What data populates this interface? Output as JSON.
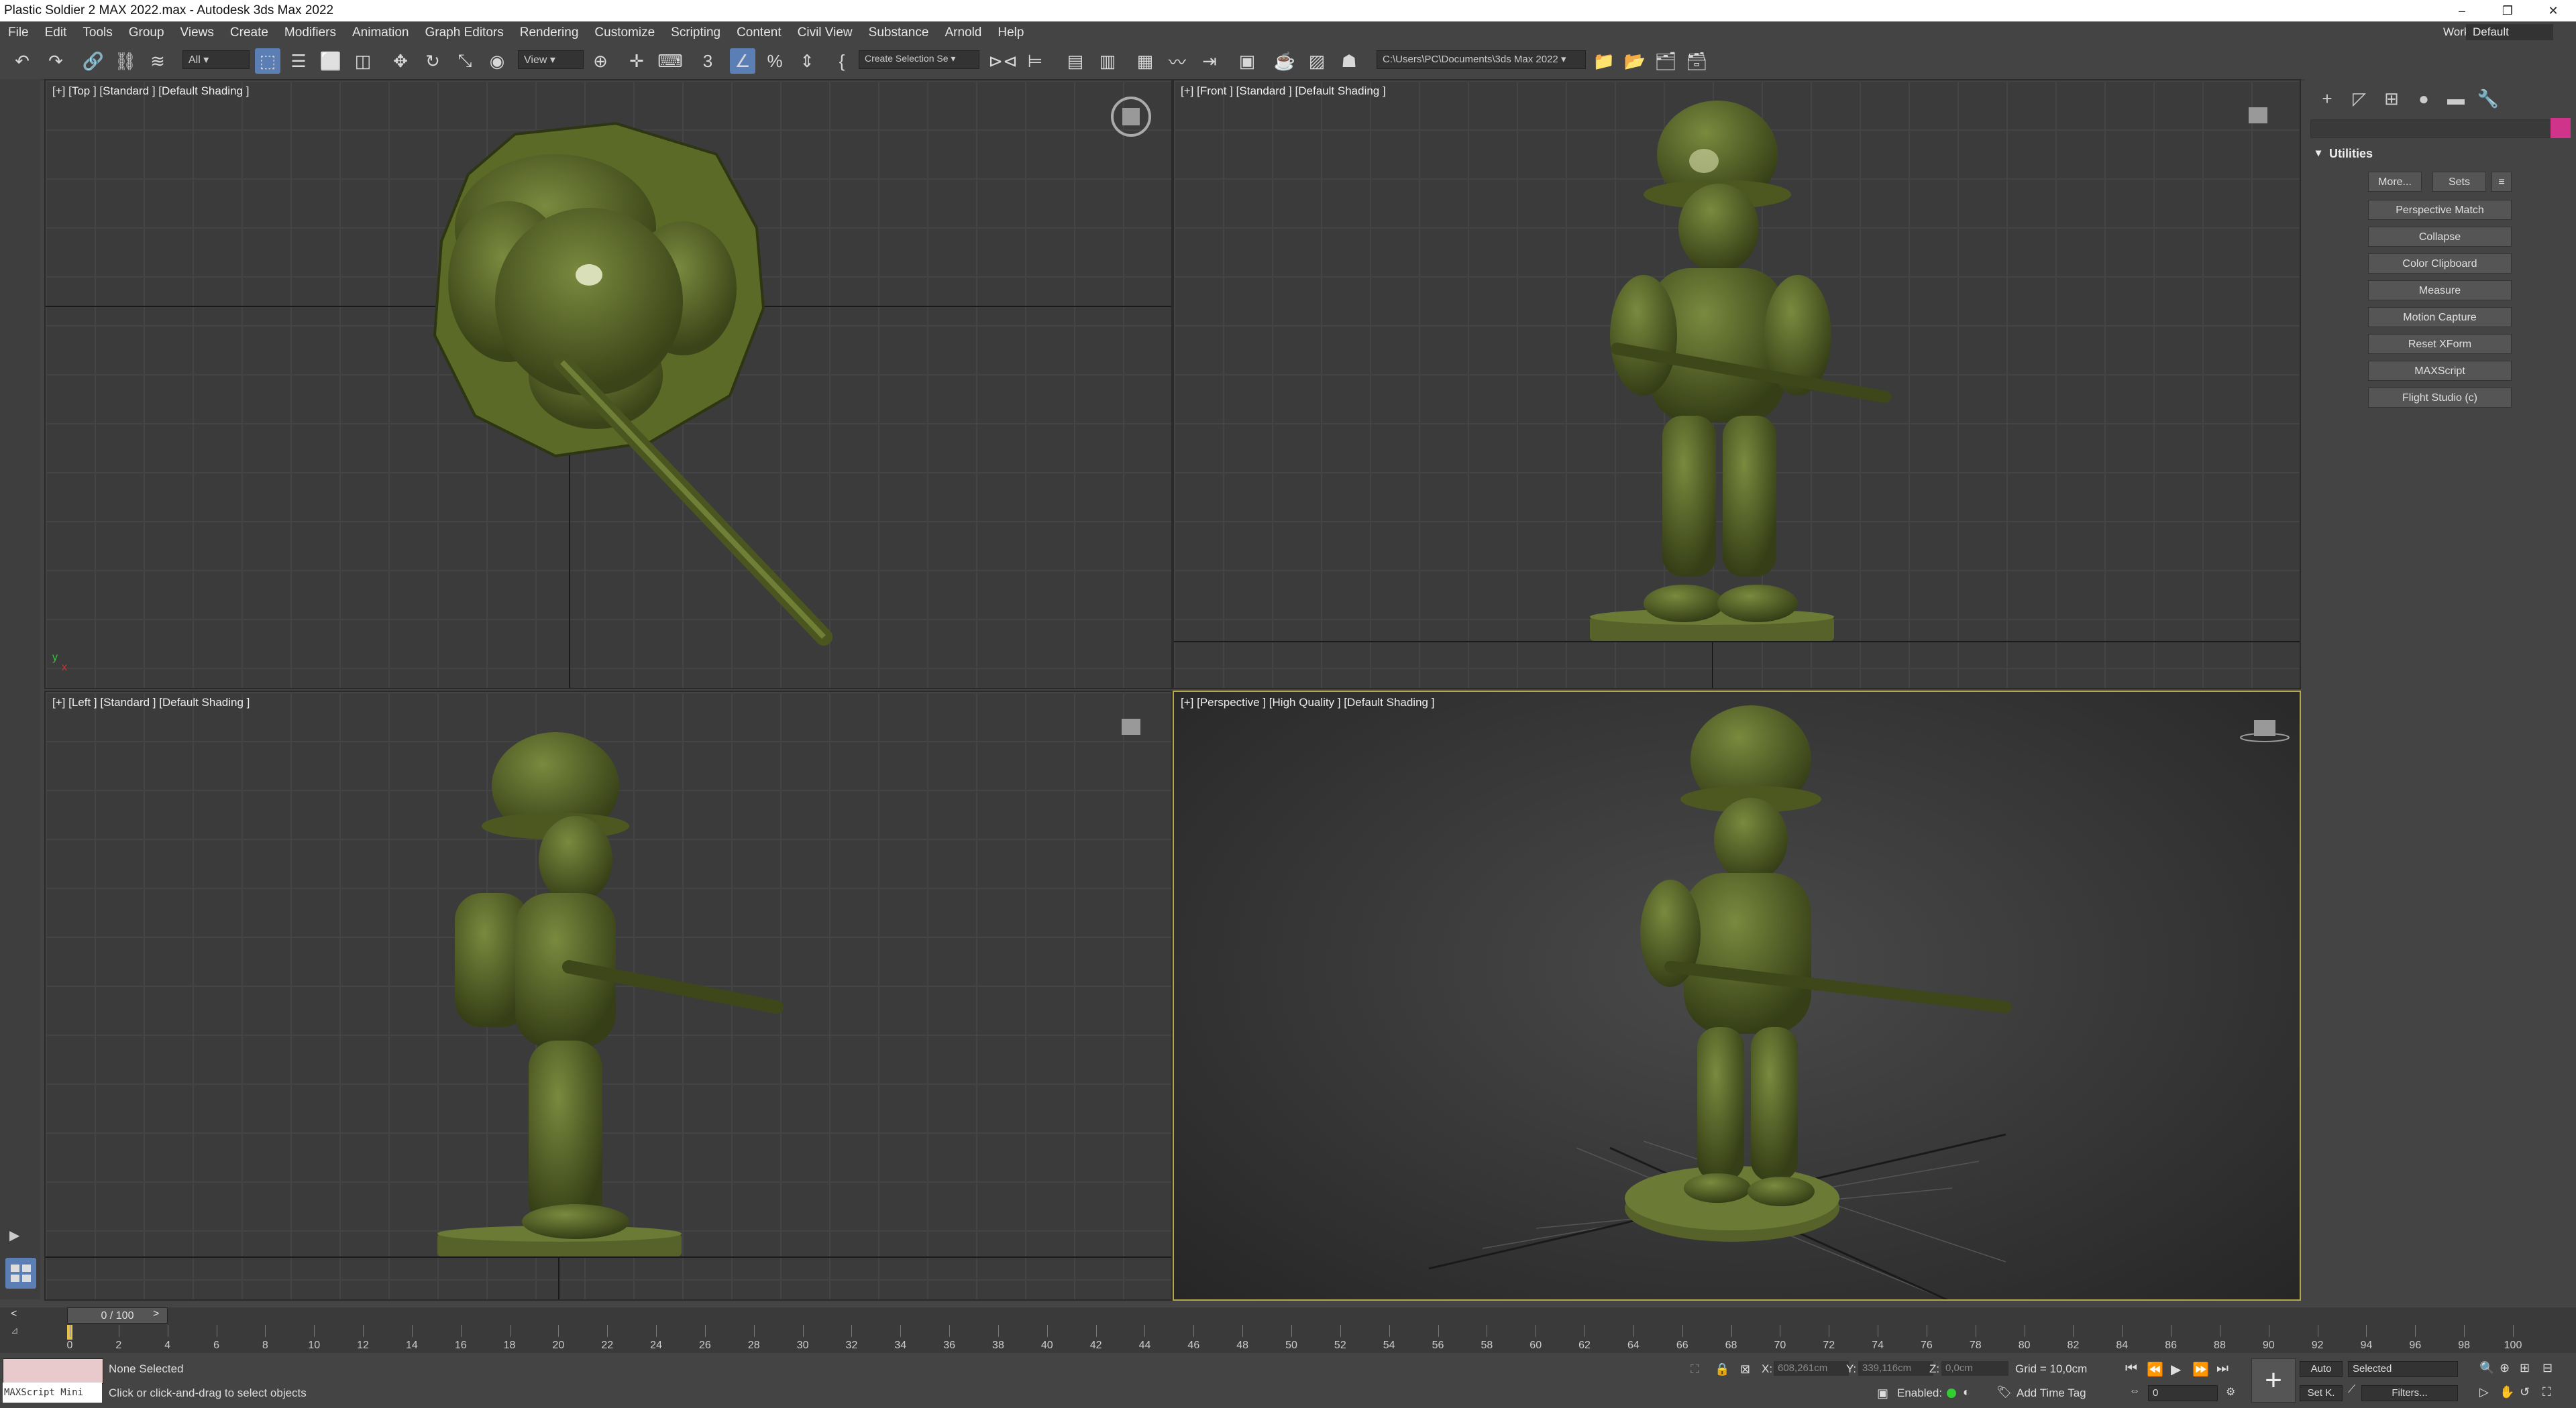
{
  "window": {
    "title": "Plastic Soldier 2 MAX 2022.max - Autodesk 3ds Max 2022",
    "buttons": [
      "–",
      "❐",
      "✕"
    ]
  },
  "menu": {
    "items": [
      "File",
      "Edit",
      "Tools",
      "Group",
      "Views",
      "Create",
      "Modifiers",
      "Animation",
      "Graph Editors",
      "Rendering",
      "Customize",
      "Scripting",
      "Content",
      "Civil View",
      "Substance",
      "Arnold",
      "Help"
    ],
    "workspaces_label": "Workspaces:",
    "workspaces_value": "Default"
  },
  "toolbar": {
    "filter_value": "All",
    "refcoord_value": "View",
    "selection_set": "Create Selection Se",
    "path": "C:\\Users\\PC\\Documents\\3ds Max 2022"
  },
  "viewports": {
    "top": {
      "label": "[+] [Top ] [Standard ] [Default Shading ]"
    },
    "front": {
      "label": "[+] [Front ] [Standard ] [Default Shading ]"
    },
    "left": {
      "label": "[+] [Left ] [Standard ] [Default Shading ]"
    },
    "persp": {
      "label": "[+] [Perspective ] [High Quality ] [Default Shading ]"
    }
  },
  "command_panel": {
    "rollout_title": "Utilities",
    "more_label": "More...",
    "sets_label": "Sets",
    "buttons": [
      "Perspective Match",
      "Collapse",
      "Color Clipboard",
      "Measure",
      "Motion Capture",
      "Reset XForm",
      "MAXScript",
      "Flight Studio (c)"
    ]
  },
  "timeline": {
    "frame_display": "0 / 100",
    "ticks": [
      "0",
      "2",
      "4",
      "6",
      "8",
      "10",
      "12",
      "14",
      "16",
      "18",
      "20",
      "22",
      "24",
      "26",
      "28",
      "30",
      "32",
      "34",
      "36",
      "38",
      "40",
      "42",
      "44",
      "46",
      "48",
      "50",
      "52",
      "54",
      "56",
      "58",
      "60",
      "62",
      "64",
      "66",
      "68",
      "70",
      "72",
      "74",
      "76",
      "78",
      "80",
      "82",
      "84",
      "86",
      "88",
      "90",
      "92",
      "94",
      "96",
      "98",
      "100"
    ]
  },
  "status": {
    "maxscript_label": "MAXScript Mini",
    "selection": "None Selected",
    "prompt": "Click or click-and-drag to select objects",
    "x_label": "X:",
    "x_value": "608,261cm",
    "y_label": "Y:",
    "y_value": "339,116cm",
    "z_label": "Z:",
    "z_value": "0,0cm",
    "grid": "Grid = 10,0cm",
    "enabled": "Enabled:",
    "add_time_tag": "Add Time Tag",
    "auto": "Auto",
    "set_key": "Set K.",
    "selected": "Selected",
    "filters": "Filters...",
    "frame_value": "0"
  },
  "colors": {
    "soldier": "#4f5a22",
    "soldier_light": "#6b7a34",
    "persp_border": "#b5a84a",
    "active_tool": "#5b7fb5"
  }
}
